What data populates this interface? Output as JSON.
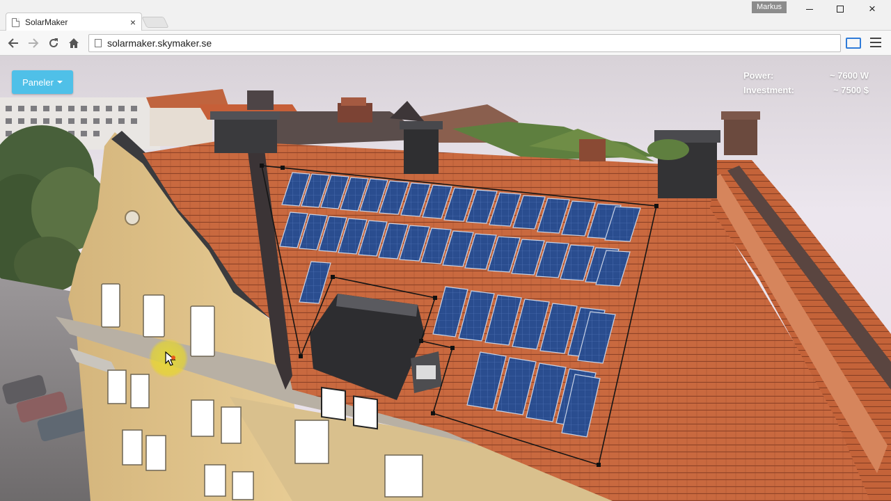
{
  "browser": {
    "tab_title": "SolarMaker",
    "tab_close": "×",
    "user_name": "Markus",
    "url": "solarmaker.skymaker.se",
    "window_close": "×"
  },
  "app": {
    "panels_button": "Paneler",
    "stats": {
      "power_label": "Power:",
      "power_value": "~ 7600 W",
      "investment_label": "Investment:",
      "investment_value": "~ 7500 $"
    }
  },
  "icons": {
    "back": "arrow-left-icon",
    "forward": "arrow-right-icon",
    "reload": "reload-icon",
    "home": "home-icon",
    "page": "page-icon",
    "cast": "cast-icon",
    "menu": "hamburger-menu-icon",
    "panels_caret": "caret-down-icon"
  },
  "colors": {
    "button_accent": "#4fc0e8",
    "roof_tile": "#c9693f",
    "panel_blue": "#2a4d8f",
    "facade": "#e1c48a",
    "cursor_highlight": "#e8dc28"
  }
}
